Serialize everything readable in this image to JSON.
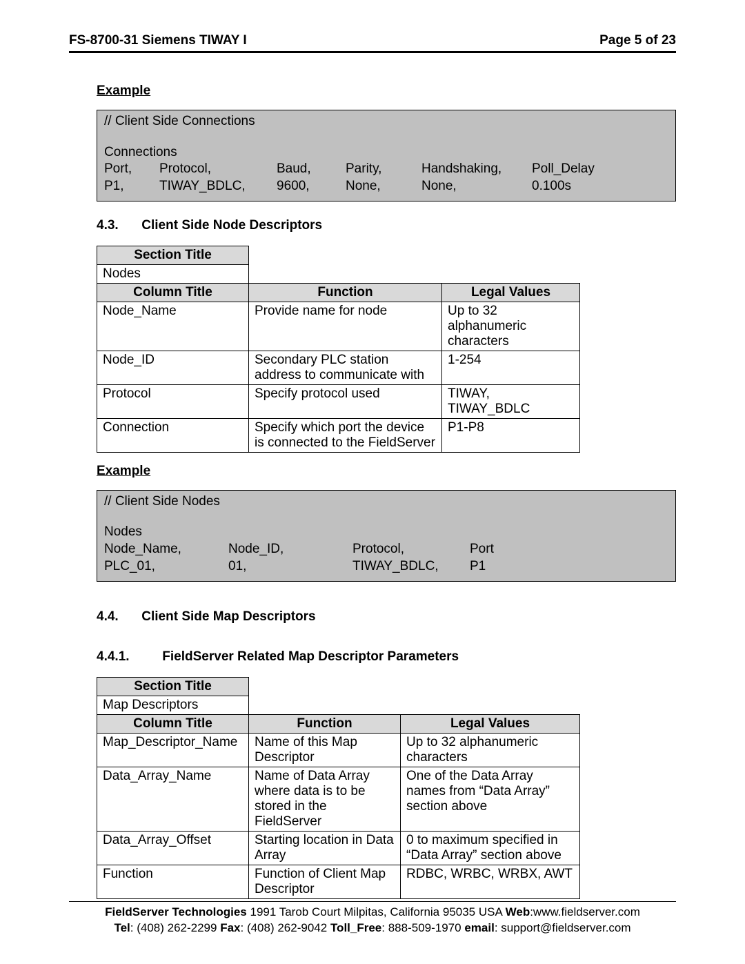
{
  "header": {
    "left": "FS-8700-31 Siemens TIWAY I",
    "right": "Page 5 of 23"
  },
  "example_label": "Example",
  "code1": {
    "comment": "//       Client Side Connections",
    "section": "Connections",
    "headers": [
      "Port,",
      "Protocol,",
      "Baud,",
      "Parity,",
      "Handshaking,",
      "Poll_Delay"
    ],
    "values": [
      "P1,",
      "TIWAY_BDLC,",
      "9600,",
      "None,",
      "None,",
      "0.100s"
    ]
  },
  "sec43": {
    "num": "4.3.",
    "title": "Client Side Node Descriptors"
  },
  "table43": {
    "section_title_label": "Section Title",
    "section_title_value": "Nodes",
    "column_title_label": "Column Title",
    "function_label": "Function",
    "legal_label": "Legal Values",
    "rows": [
      {
        "c": "Node_Name",
        "f": "Provide name for node",
        "l": "Up to 32 alphanumeric characters"
      },
      {
        "c": "Node_ID",
        "f": "Secondary PLC station address to communicate with",
        "l": "1-254"
      },
      {
        "c": "Protocol",
        "f": "Specify protocol used",
        "l": "TIWAY, TIWAY_BDLC"
      },
      {
        "c": "Connection",
        "f": "Specify which port the device is connected to the FieldServer",
        "l": "P1-P8"
      }
    ]
  },
  "code2": {
    "comment": "//    Client Side Nodes",
    "section": "Nodes",
    "headers": [
      "Node_Name,",
      "Node_ID,",
      "Protocol,",
      "Port"
    ],
    "values": [
      "PLC_01,",
      "01,",
      "TIWAY_BDLC,",
      "P1"
    ]
  },
  "sec44": {
    "num": "4.4.",
    "title": "Client Side Map Descriptors"
  },
  "sec441": {
    "num": "4.4.1.",
    "title": "FieldServer Related Map Descriptor Parameters"
  },
  "table441": {
    "section_title_label": "Section Title",
    "section_title_value": "Map Descriptors",
    "column_title_label": "Column Title",
    "function_label": "Function",
    "legal_label": "Legal Values",
    "rows": [
      {
        "c": "Map_Descriptor_Name",
        "f": "Name of this Map Descriptor",
        "l": "Up to 32 alphanumeric characters"
      },
      {
        "c": "Data_Array_Name",
        "f": "Name of Data Array where data is to be stored in the FieldServer",
        "l": "One of the Data Array names from “Data Array” section above"
      },
      {
        "c": "Data_Array_Offset",
        "f": "Starting location in Data Array",
        "l": "0 to maximum specified in “Data Array” section above"
      },
      {
        "c": "Function",
        "f": "Function of Client Map Descriptor",
        "l": "RDBC, WRBC, WRBX, AWT"
      }
    ]
  },
  "footer": {
    "company": "FieldServer Technologies",
    "address": "1991 Tarob Court Milpitas, California 95035 USA",
    "web_label": "Web",
    "web": ":www.fieldserver.com",
    "tel_label": "Tel",
    "tel": ": (408) 262-2299",
    "fax_label": "Fax",
    "fax": ": (408) 262-9042",
    "toll_label": "Toll_Free",
    "toll": ": 888-509-1970",
    "email_label": "email",
    "email": ": support@fieldserver.com"
  }
}
